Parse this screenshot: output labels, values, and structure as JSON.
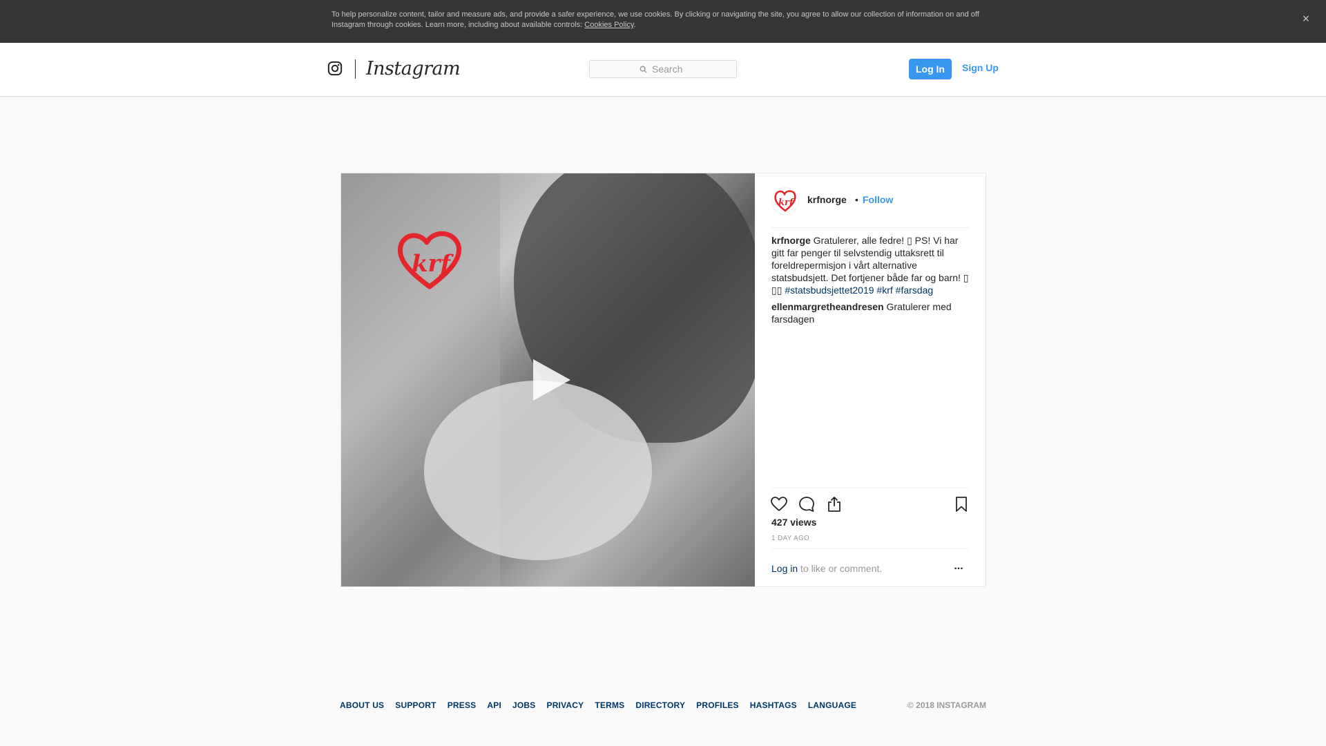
{
  "cookie_banner": {
    "text": "To help personalize content, tailor and measure ads, and provide a safer experience, we use cookies. By clicking or navigating the site, you agree to allow our collection of information on and off Instagram through cookies. Learn more, including about available controls: ",
    "link": "Cookies Policy",
    "trailing": ".",
    "close_icon": "×"
  },
  "header": {
    "wordmark": "Instagram",
    "search_placeholder": "Search",
    "login_label": "Log In",
    "signup_label": "Sign Up"
  },
  "post": {
    "username": "krfnorge",
    "separator": "•",
    "follow_label": "Follow",
    "caption": {
      "user": "krfnorge",
      "text": " Gratulerer, alle fedre! ▯  PS! Vi har gitt far penger til selvstendig uttaksrett til foreldrepermisjon i vårt alternative statsbudsjett. Det fortjener både far og barn! ▯ ▯▯ ",
      "hashtags": [
        "#statsbudsjettet2019",
        "#krf",
        "#farsdag"
      ]
    },
    "comments": [
      {
        "user": "ellenmargretheandresen",
        "text": " Gratulerer med farsdagen"
      }
    ],
    "views": "427 views",
    "timestamp": "1 DAY AGO",
    "login_link": "Log in",
    "login_text": "to like or comment.",
    "more_label": "..."
  },
  "footer": {
    "links": [
      "ABOUT US",
      "SUPPORT",
      "PRESS",
      "API",
      "JOBS",
      "PRIVACY",
      "TERMS",
      "DIRECTORY",
      "PROFILES",
      "HASHTAGS",
      "LANGUAGE"
    ],
    "copyright": "© 2018 INSTAGRAM"
  },
  "colors": {
    "accent": "#3897f0",
    "link_dark": "#003569",
    "brand_red": "#e3262b",
    "banner_bg": "#363636"
  },
  "icons": [
    "instagram-glyph-icon",
    "search-icon",
    "play-icon",
    "heart-icon",
    "comment-icon",
    "share-icon",
    "bookmark-icon",
    "more-icon",
    "close-icon",
    "krf-logo"
  ]
}
